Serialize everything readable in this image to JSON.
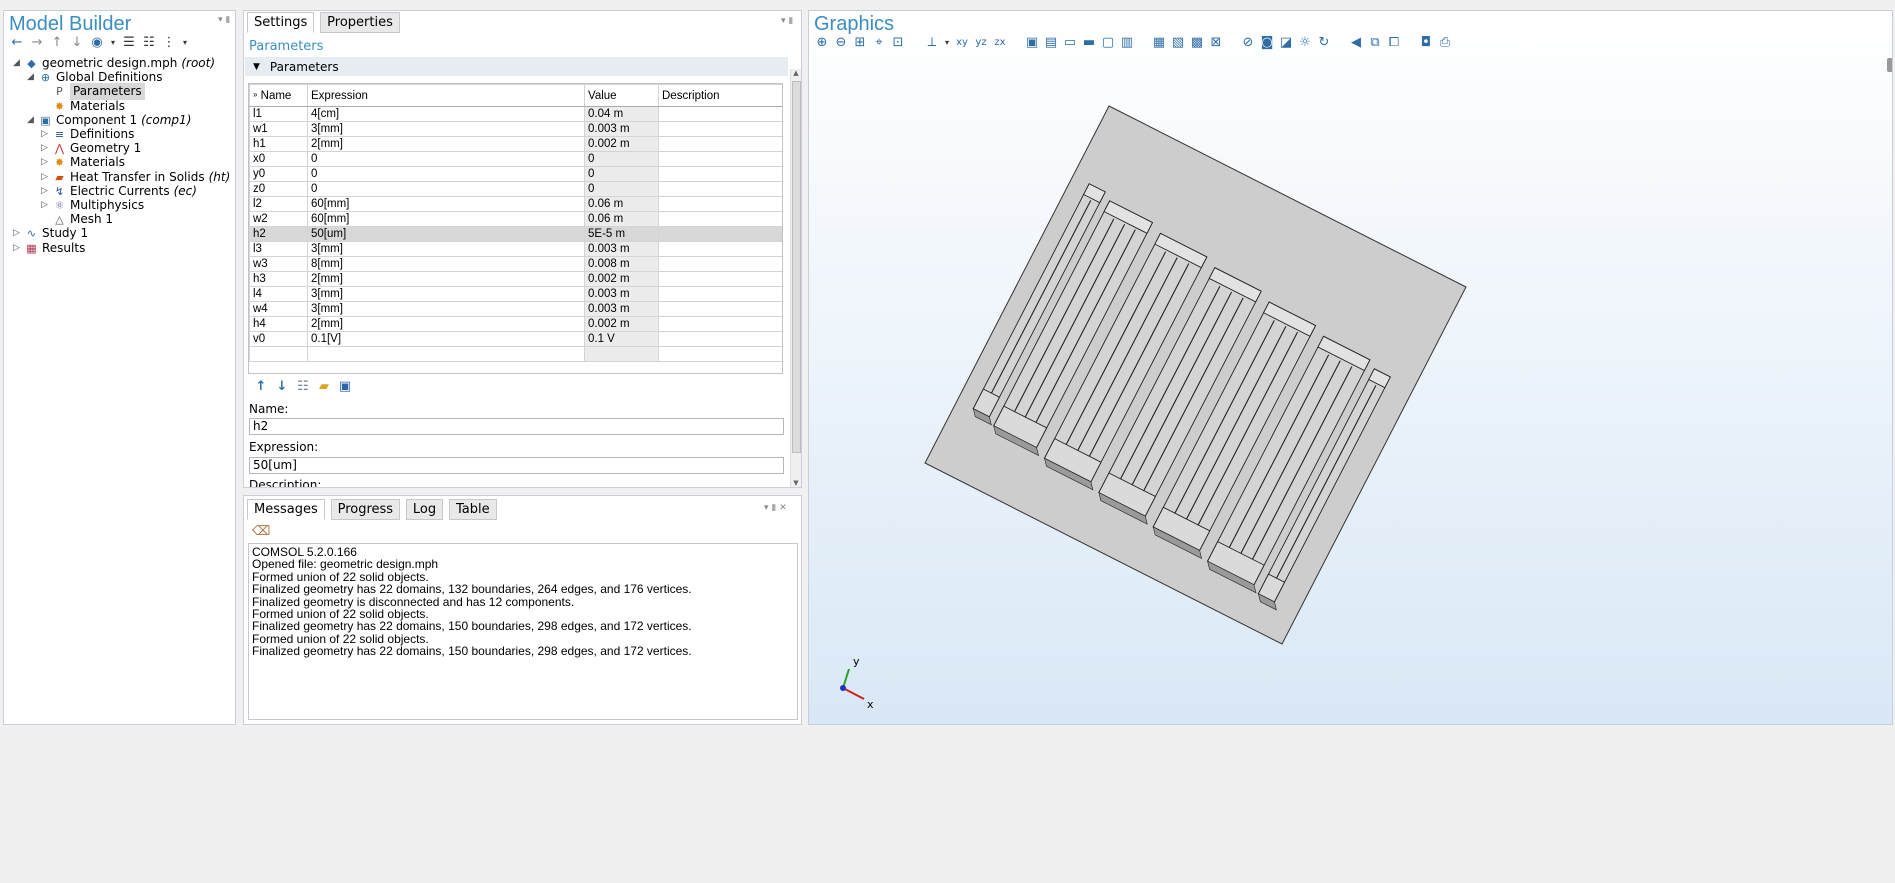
{
  "model_builder": {
    "title": "Model Builder",
    "tree": [
      {
        "label": "geometric design.mph",
        "suffix": "(root)",
        "icon": "model-icon",
        "twisty": "◢",
        "level": 0
      },
      {
        "label": "Global Definitions",
        "suffix": "",
        "icon": "globe-icon",
        "twisty": "◢",
        "level": 1
      },
      {
        "label": "Parameters",
        "suffix": "",
        "icon": "parameters-icon",
        "twisty": "",
        "level": 2,
        "selected": true
      },
      {
        "label": "Materials",
        "suffix": "",
        "icon": "materials-icon",
        "twisty": "",
        "level": 2
      },
      {
        "label": "Component 1",
        "suffix": "(comp1)",
        "icon": "component-icon",
        "twisty": "◢",
        "level": 1
      },
      {
        "label": "Definitions",
        "suffix": "",
        "icon": "definitions-icon",
        "twisty": "▷",
        "level": 2
      },
      {
        "label": "Geometry 1",
        "suffix": "",
        "icon": "geometry-icon",
        "twisty": "▷",
        "level": 2
      },
      {
        "label": "Materials",
        "suffix": "",
        "icon": "materials-icon",
        "twisty": "▷",
        "level": 2
      },
      {
        "label": "Heat Transfer in Solids",
        "suffix": "(ht)",
        "icon": "heat-transfer-icon",
        "twisty": "▷",
        "level": 2
      },
      {
        "label": "Electric Currents",
        "suffix": "(ec)",
        "icon": "electric-currents-icon",
        "twisty": "▷",
        "level": 2
      },
      {
        "label": "Multiphysics",
        "suffix": "",
        "icon": "multiphysics-icon",
        "twisty": "▷",
        "level": 2
      },
      {
        "label": "Mesh 1",
        "suffix": "",
        "icon": "mesh-icon",
        "twisty": "",
        "level": 2
      },
      {
        "label": "Study 1",
        "suffix": "",
        "icon": "study-icon",
        "twisty": "▷",
        "level": 0
      },
      {
        "label": "Results",
        "suffix": "",
        "icon": "results-icon",
        "twisty": "▷",
        "level": 0
      }
    ]
  },
  "settings": {
    "tabs": [
      "Settings",
      "Properties"
    ],
    "heading": "Parameters",
    "section": "Parameters",
    "columns": [
      "Name",
      "Expression",
      "Value",
      "Description"
    ],
    "rows": [
      {
        "name": "l1",
        "expression": "4[cm]",
        "value": "0.04 m",
        "description": ""
      },
      {
        "name": "w1",
        "expression": "3[mm]",
        "value": "0.003 m",
        "description": ""
      },
      {
        "name": "h1",
        "expression": "2[mm]",
        "value": "0.002 m",
        "description": ""
      },
      {
        "name": "x0",
        "expression": "0",
        "value": "0",
        "description": ""
      },
      {
        "name": "y0",
        "expression": "0",
        "value": "0",
        "description": ""
      },
      {
        "name": "z0",
        "expression": "0",
        "value": "0",
        "description": ""
      },
      {
        "name": "l2",
        "expression": "60[mm]",
        "value": "0.06 m",
        "description": ""
      },
      {
        "name": "w2",
        "expression": "60[mm]",
        "value": "0.06 m",
        "description": ""
      },
      {
        "name": "h2",
        "expression": "50[um]",
        "value": "5E-5 m",
        "description": "",
        "selected": true
      },
      {
        "name": "l3",
        "expression": "3[mm]",
        "value": "0.003 m",
        "description": ""
      },
      {
        "name": "w3",
        "expression": "8[mm]",
        "value": "0.008 m",
        "description": ""
      },
      {
        "name": "h3",
        "expression": "2[mm]",
        "value": "0.002 m",
        "description": ""
      },
      {
        "name": "l4",
        "expression": "3[mm]",
        "value": "0.003 m",
        "description": ""
      },
      {
        "name": "w4",
        "expression": "3[mm]",
        "value": "0.003 m",
        "description": ""
      },
      {
        "name": "h4",
        "expression": "2[mm]",
        "value": "0.002 m",
        "description": ""
      },
      {
        "name": "v0",
        "expression": "0.1[V]",
        "value": "0.1 V",
        "description": ""
      },
      {
        "name": "",
        "expression": "",
        "value": "",
        "description": ""
      }
    ],
    "name_label": "Name:",
    "name_value": "h2",
    "expression_label": "Expression:",
    "expression_value": "50[um]",
    "description_label": "Description:"
  },
  "messages": {
    "tabs": [
      "Messages",
      "Progress",
      "Log",
      "Table"
    ],
    "lines": [
      "COMSOL 5.2.0.166",
      "Opened file: geometric design.mph",
      "Formed union of 22 solid objects.",
      "Finalized geometry has 22 domains, 132 boundaries, 264 edges, and 176 vertices.",
      "Finalized geometry is disconnected and has 12 components.",
      "Formed union of 22 solid objects.",
      "Finalized geometry has 22 domains, 150 boundaries, 298 edges, and 172 vertices.",
      "Formed union of 22 solid objects.",
      "Finalized geometry has 22 domains, 150 boundaries, 298 edges, and 172 vertices."
    ]
  },
  "graphics": {
    "title": "Graphics",
    "axis_y": "y",
    "axis_x": "x",
    "toolbar_xy": "xy",
    "toolbar_yz": "yz",
    "toolbar_zx": "zx"
  },
  "colors": {
    "accent": "#3b8ec4",
    "selection": "#d8d8d8",
    "graphics_bg_top": "#ffffff",
    "graphics_bg_bottom": "#d9e8f6"
  }
}
